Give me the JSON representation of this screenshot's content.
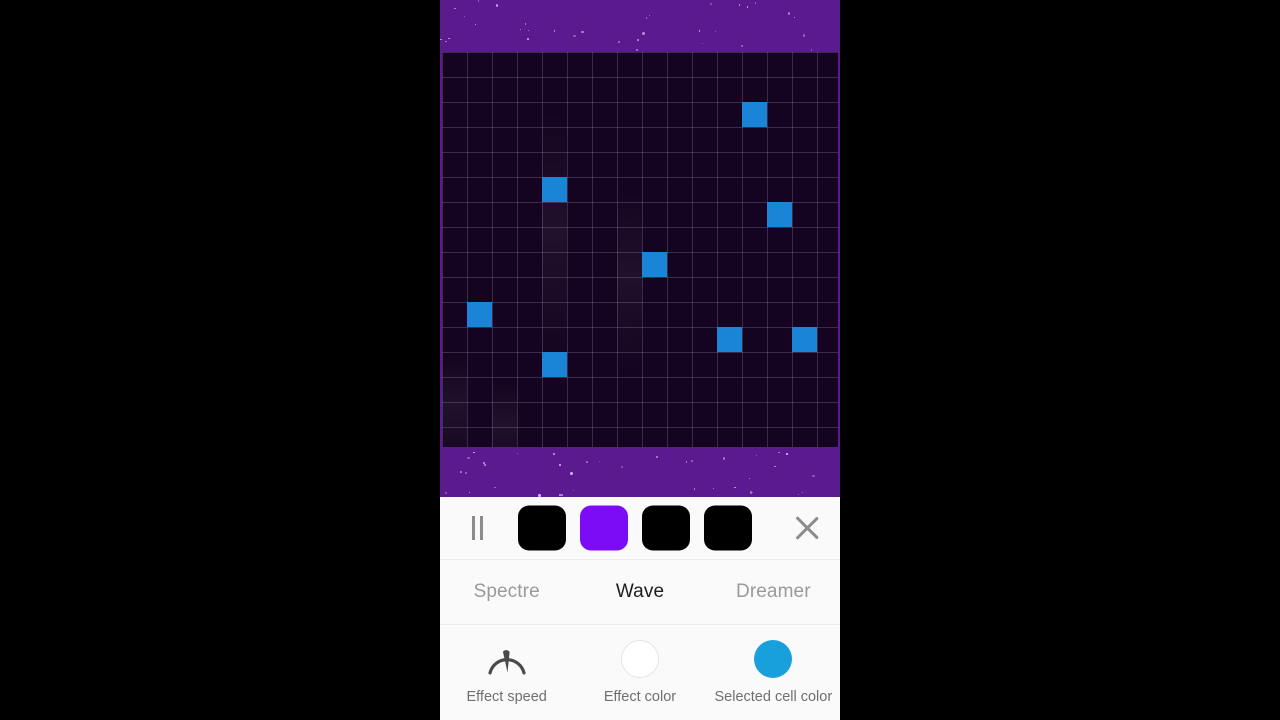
{
  "app": {
    "background_color": "#5B1A90",
    "grid_background": "#140421",
    "cell_on_color": "#1A84D6",
    "accent_purple": "#7B0CF5"
  },
  "grid": {
    "columns": 16,
    "rows": 16,
    "cell_size": 25,
    "active_cells": [
      {
        "col": 12,
        "row": 2
      },
      {
        "col": 4,
        "row": 5
      },
      {
        "col": 13,
        "row": 6
      },
      {
        "col": 8,
        "row": 8
      },
      {
        "col": 1,
        "row": 10
      },
      {
        "col": 11,
        "row": 11
      },
      {
        "col": 14,
        "row": 11
      },
      {
        "col": 4,
        "row": 12
      }
    ]
  },
  "toolbar": {
    "pause_label": "pause-button",
    "close_label": "close-button",
    "swatches": [
      {
        "name": "swatch-1",
        "color": "#000000",
        "selected": false
      },
      {
        "name": "swatch-2",
        "color": "#7B0CF5",
        "selected": true
      },
      {
        "name": "swatch-3",
        "color": "#000000",
        "selected": false
      },
      {
        "name": "swatch-4",
        "color": "#000000",
        "selected": false
      }
    ]
  },
  "effects": {
    "items": [
      {
        "label": "Spectre",
        "active": false
      },
      {
        "label": "Wave",
        "active": true
      },
      {
        "label": "Dreamer",
        "active": false
      }
    ]
  },
  "options": [
    {
      "label": "Effect speed",
      "icon": "speedometer-icon",
      "color": null
    },
    {
      "label": "Effect color",
      "icon": "color-circle-icon",
      "color": "#FFFFFF"
    },
    {
      "label": "Selected cell color",
      "icon": "color-circle-icon",
      "color": "#18A0DC"
    }
  ]
}
